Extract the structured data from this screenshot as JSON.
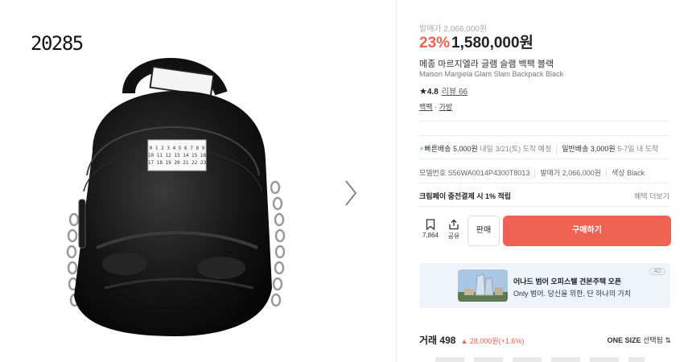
{
  "image_panel": {
    "watermark": "20285",
    "label_numbers": [
      "0 1 2 3 4 5 6 7 8 9",
      "10 11 12 13 14 15 16",
      "17 18 19 20 21 22 23"
    ],
    "next_icon": "chevron-right-icon"
  },
  "product": {
    "original_price": "발매가 2,066,000원",
    "discount": "23%",
    "price": "1,580,000원",
    "name_ko": "메종 마르지엘라 글램 슬램 백팩 블랙",
    "name_en": "Maison Margiela Glam Slam Backpack Black",
    "rating_star": "★",
    "rating": "4.8",
    "review_label": "리뷰 66",
    "category_1": "백팩",
    "category_sep": " · ",
    "category_2": "가방"
  },
  "shipping": {
    "fast_icon": "⚡",
    "fast_label": "빠른배송 5,000원",
    "fast_note": " 내일 3/21(토) 도착 예정",
    "normal_label": "일반배송 3,000원",
    "normal_note": " 5-7일 내 도착"
  },
  "info": {
    "model": "모델번호 S56WA0014P4300T8013",
    "release": "발매가 2,066,000원",
    "color": "색상 Black"
  },
  "cardpay": {
    "text": "크림페이 중전결제 시 1% 적립",
    "more": "혜택 더보기"
  },
  "actions": {
    "bookmark_count": "7,864",
    "share_label": "공유",
    "sell_label": "판매",
    "buy_label": "구매하기"
  },
  "banner": {
    "ad": "AD",
    "title": "어나드 범어 오피스텔 견본주택 오픈",
    "subtitle": "Only 범어. 당신을 위한, 단 하나의 가치"
  },
  "trade": {
    "label": "거래 498",
    "change": "▲ 28,000원(+1.6%)",
    "size": "ONE SIZE",
    "size_select": "선택됨 ⇅"
  },
  "colors": {
    "accent": "#ef6253",
    "fast": "#22b14c",
    "banner_bg": "#eff4fb"
  }
}
